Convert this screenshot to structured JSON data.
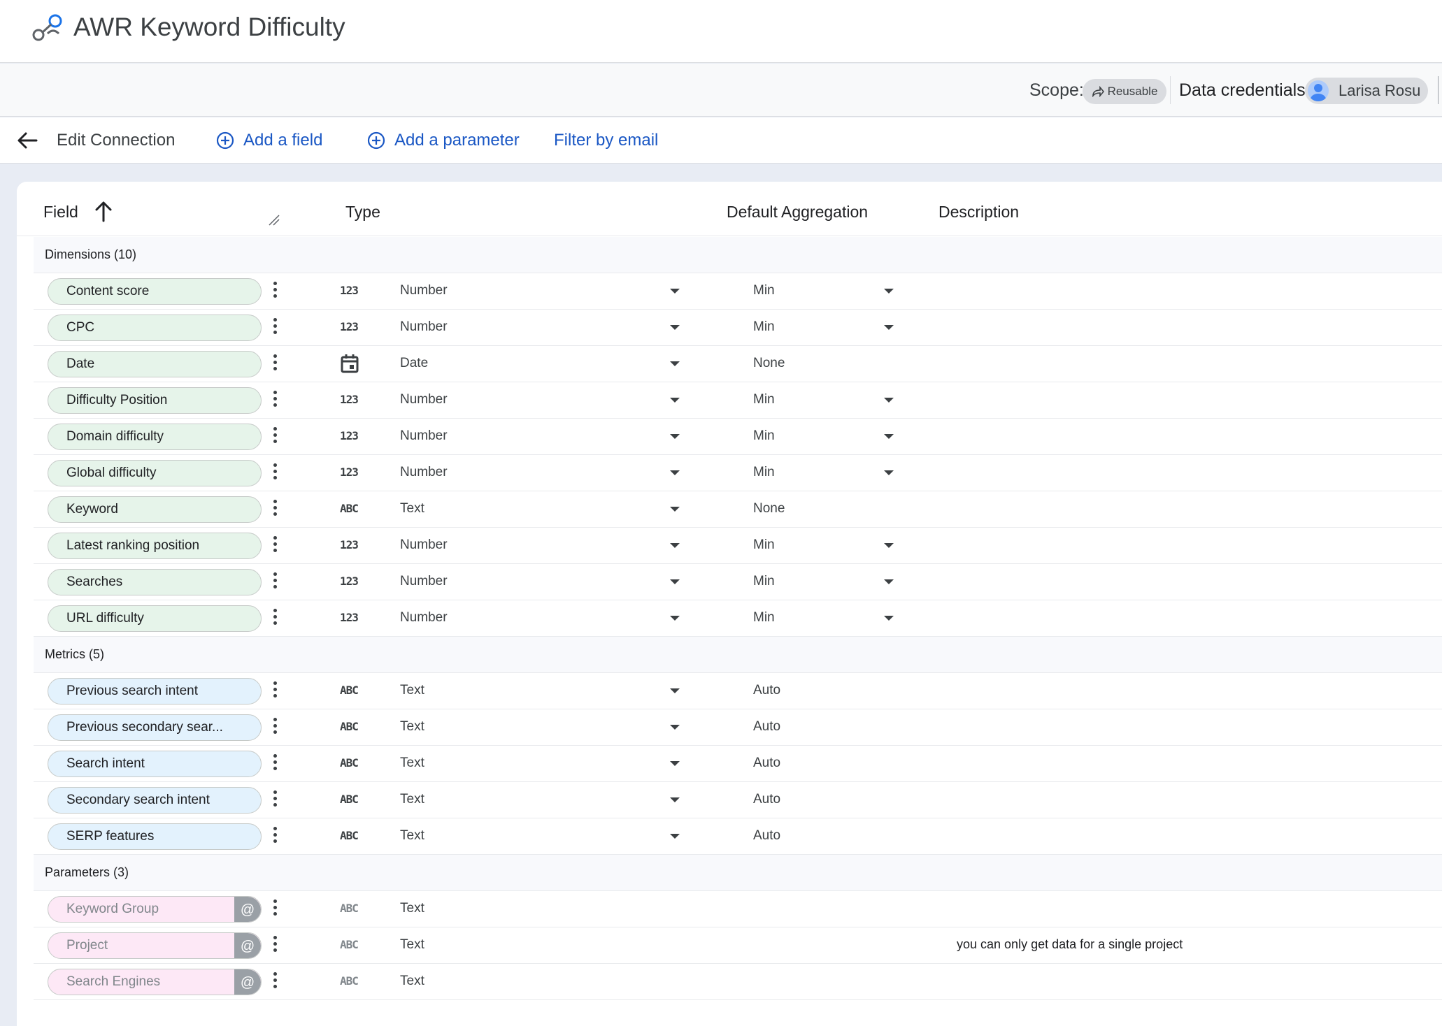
{
  "app": {
    "title": "AWR Keyword Difficulty"
  },
  "scope": {
    "label": "Scope:",
    "chip": "Reusable"
  },
  "credentials": {
    "label": "Data credentials:",
    "user": "Larisa Rosu"
  },
  "toolbar": {
    "edit_connection": "Edit Connection",
    "add_field": "Add a field",
    "add_parameter": "Add a parameter",
    "filter_by_email": "Filter by email"
  },
  "columns": {
    "field": "Field",
    "type": "Type",
    "aggregation": "Default Aggregation",
    "description": "Description"
  },
  "sections": {
    "dimensions": "Dimensions (10)",
    "metrics": "Metrics (5)",
    "parameters": "Parameters (3)"
  },
  "dimensions": [
    {
      "name": "Content score",
      "icon": "123",
      "type": "Number",
      "agg": "Min",
      "agg_dropdown": true
    },
    {
      "name": "CPC",
      "icon": "123",
      "type": "Number",
      "agg": "Min",
      "agg_dropdown": true
    },
    {
      "name": "Date",
      "icon": "calendar-icon",
      "type": "Date",
      "agg": "None",
      "agg_dropdown": false
    },
    {
      "name": "Difficulty Position",
      "icon": "123",
      "type": "Number",
      "agg": "Min",
      "agg_dropdown": true
    },
    {
      "name": "Domain difficulty",
      "icon": "123",
      "type": "Number",
      "agg": "Min",
      "agg_dropdown": true
    },
    {
      "name": "Global difficulty",
      "icon": "123",
      "type": "Number",
      "agg": "Min",
      "agg_dropdown": true
    },
    {
      "name": "Keyword",
      "icon": "ABC",
      "type": "Text",
      "agg": "None",
      "agg_dropdown": false
    },
    {
      "name": "Latest ranking position",
      "icon": "123",
      "type": "Number",
      "agg": "Min",
      "agg_dropdown": true
    },
    {
      "name": "Searches",
      "icon": "123",
      "type": "Number",
      "agg": "Min",
      "agg_dropdown": true
    },
    {
      "name": "URL difficulty",
      "icon": "123",
      "type": "Number",
      "agg": "Min",
      "agg_dropdown": true
    }
  ],
  "metrics": [
    {
      "name": "Previous search intent",
      "icon": "ABC",
      "type": "Text",
      "agg": "Auto"
    },
    {
      "name": "Previous secondary sear...",
      "icon": "ABC",
      "type": "Text",
      "agg": "Auto"
    },
    {
      "name": "Search intent",
      "icon": "ABC",
      "type": "Text",
      "agg": "Auto"
    },
    {
      "name": "Secondary search intent",
      "icon": "ABC",
      "type": "Text",
      "agg": "Auto"
    },
    {
      "name": "SERP features",
      "icon": "ABC",
      "type": "Text",
      "agg": "Auto"
    }
  ],
  "parameters": [
    {
      "name": "Keyword Group",
      "icon": "ABC",
      "type": "Text",
      "at": "@",
      "description": ""
    },
    {
      "name": "Project",
      "icon": "ABC",
      "type": "Text",
      "at": "@",
      "description": "you can only get data for a single project"
    },
    {
      "name": "Search Engines",
      "icon": "ABC",
      "type": "Text",
      "at": "@",
      "description": ""
    }
  ],
  "colors": {
    "accent": "#1a57c4",
    "dimension_pill": "#e6f4ea",
    "metric_pill": "#e3f2fd",
    "parameter_pill": "#fde8f6"
  }
}
